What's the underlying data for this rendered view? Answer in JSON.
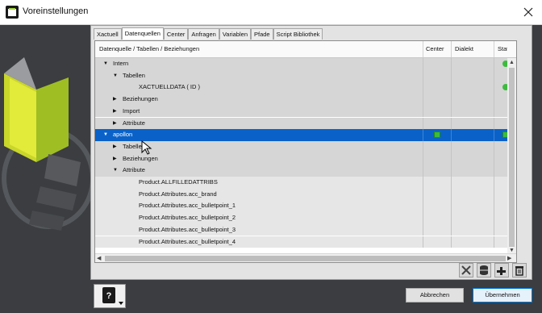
{
  "window": {
    "title": "Voreinstellungen",
    "close_icon": "close-icon"
  },
  "tabs": [
    {
      "label": "Xactuell",
      "active": false
    },
    {
      "label": "Datenquellen",
      "active": true
    },
    {
      "label": "Center",
      "active": false
    },
    {
      "label": "Anfragen",
      "active": false
    },
    {
      "label": "Variablen",
      "active": false
    },
    {
      "label": "Pfade",
      "active": false
    },
    {
      "label": "Script Bibliothek",
      "active": false
    }
  ],
  "grid": {
    "columns": [
      "Datenquelle / Tabellen / Beziehungen",
      "Center",
      "Dialekt",
      "Status"
    ],
    "rows": [
      {
        "label": "Intern",
        "level": 0,
        "expander": "down",
        "status": "green",
        "center": ""
      },
      {
        "label": "Tabellen",
        "level": 1,
        "expander": "down",
        "status": "",
        "center": ""
      },
      {
        "label": "XACTUELLDATA ( ID )",
        "level": 2,
        "expander": "",
        "status": "green",
        "center": ""
      },
      {
        "label": "Beziehungen",
        "level": 1,
        "expander": "right",
        "status": "",
        "center": ""
      },
      {
        "label": "Import",
        "level": 1,
        "expander": "right",
        "status": "",
        "center": ""
      },
      {
        "label": "Attribute",
        "level": 1,
        "expander": "right",
        "status": "",
        "center": ""
      },
      {
        "label": "apollon",
        "level": 0,
        "expander": "down",
        "status": "green",
        "center": "green",
        "selected": true
      },
      {
        "label": "Tabellen",
        "level": 1,
        "expander": "right",
        "status": "",
        "center": ""
      },
      {
        "label": "Beziehungen",
        "level": 1,
        "expander": "right",
        "status": "",
        "center": ""
      },
      {
        "label": "Attribute",
        "level": 1,
        "expander": "down",
        "status": "",
        "center": ""
      },
      {
        "label": "Product.ALLFILLEDATTRIBS",
        "level": 2,
        "expander": "",
        "status": "",
        "center": ""
      },
      {
        "label": "Product.Attributes.acc_brand",
        "level": 2,
        "expander": "",
        "status": "",
        "center": ""
      },
      {
        "label": "Product.Attributes.acc_bulletpoint_1",
        "level": 2,
        "expander": "",
        "status": "",
        "center": ""
      },
      {
        "label": "Product.Attributes.acc_bulletpoint_2",
        "level": 2,
        "expander": "",
        "status": "",
        "center": ""
      },
      {
        "label": "Product.Attributes.acc_bulletpoint_3",
        "level": 2,
        "expander": "",
        "status": "",
        "center": ""
      },
      {
        "label": "Product.Attributes.acc_bulletpoint_4",
        "level": 2,
        "expander": "",
        "status": "",
        "center": ""
      }
    ]
  },
  "toolbar_icons": [
    "tools-icon",
    "database-icon",
    "add-icon",
    "trash-icon"
  ],
  "buttons": {
    "cancel": "Abbrechen",
    "ok": "Übernehmen"
  },
  "help_icon": "help-manual-icon",
  "colors": {
    "selection": "#0a62c8",
    "status_green": "#3dbb3d"
  }
}
